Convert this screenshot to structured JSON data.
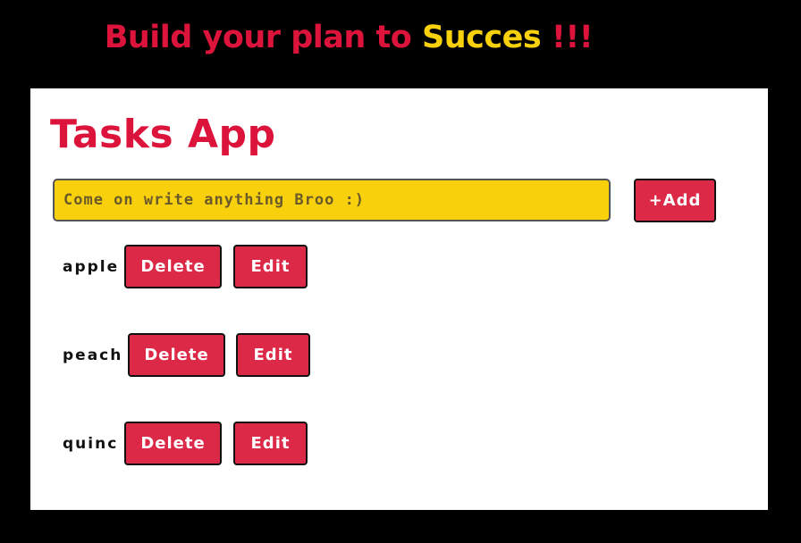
{
  "banner": {
    "part1": "Build your plan to ",
    "part2": "Succes",
    "part3": " !!!"
  },
  "app": {
    "title": "Tasks App",
    "input": {
      "value": "",
      "placeholder": "Come on write anything Broo :)"
    },
    "add_label": "+Add",
    "tasks": [
      {
        "name": "apple",
        "delete_label": "Delete",
        "edit_label": "Edit"
      },
      {
        "name": "peach",
        "delete_label": "Delete",
        "edit_label": "Edit"
      },
      {
        "name": "quinc",
        "delete_label": "Delete",
        "edit_label": "Edit"
      }
    ]
  },
  "colors": {
    "background": "#000000",
    "card": "#ffffff",
    "accent_red": "#dc143c",
    "accent_yellow": "#f8d00c"
  }
}
